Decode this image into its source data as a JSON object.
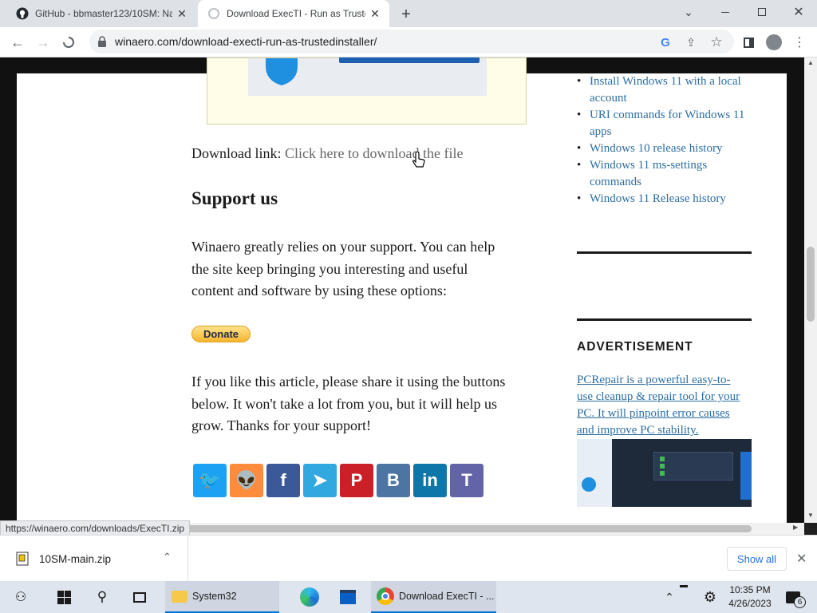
{
  "browser": {
    "tabs": [
      {
        "title": "GitHub - bbmaster123/10SM: Na",
        "active": false
      },
      {
        "title": "Download ExecTI - Run as Truste",
        "active": true
      }
    ],
    "url": "winaero.com/download-execti-run-as-trustedinstaller/",
    "status_url": "https://winaero.com/downloads/ExecTI.zip"
  },
  "article": {
    "download_label": "Download link:",
    "download_link": "Click here to download the file",
    "support_heading": "Support us",
    "support_lines": [
      "Winaero greatly relies on your support. You can help",
      "the site keep bringing you interesting and useful",
      "content and software by using these options:"
    ],
    "donate_label": "Donate",
    "share_lines": [
      "If you like this article, please share it using the buttons",
      "below. It won't take a lot from you, but it will help us",
      "grow. Thanks for your support!"
    ],
    "share_buttons": [
      {
        "icon": "twitter-icon",
        "glyph": "🐦",
        "color": "#1da1f2"
      },
      {
        "icon": "reddit-icon",
        "glyph": "👽",
        "color": "#ff8b3d"
      },
      {
        "icon": "facebook-icon",
        "glyph": "f",
        "color": "#3b5998"
      },
      {
        "icon": "telegram-icon",
        "glyph": "➤",
        "color": "#32a8e0"
      },
      {
        "icon": "pinterest-icon",
        "glyph": "P",
        "color": "#cb2027"
      },
      {
        "icon": "vk-icon",
        "glyph": "B",
        "color": "#4c75a3"
      },
      {
        "icon": "linkedin-icon",
        "glyph": "in",
        "color": "#0e76a8"
      },
      {
        "icon": "teams-icon",
        "glyph": "T",
        "color": "#6264a7"
      }
    ]
  },
  "sidebar": {
    "links": [
      {
        "lines": [
          "Install Windows 11 with a local",
          "account"
        ]
      },
      {
        "lines": [
          "URI commands for Windows 11",
          "apps"
        ]
      },
      {
        "lines": [
          "Windows 10 release history"
        ]
      },
      {
        "lines": [
          "Windows 11 ms-settings",
          "commands"
        ]
      },
      {
        "lines": [
          "Windows 11 Release history"
        ]
      }
    ],
    "ad_heading": "ADVERTISEMENT",
    "ad_lines": [
      "PCRepair is a powerful easy-to-",
      "use cleanup & repair tool for your",
      "PC. It will pinpoint error causes",
      "and improve PC stability."
    ]
  },
  "downloads": {
    "file_name": "10SM-main.zip",
    "show_all": "Show all"
  },
  "taskbar": {
    "explorer_label": "System32",
    "chrome_label": "Download ExecTI - ...",
    "time": "10:35 PM",
    "date": "4/26/2023",
    "notification_count": "6"
  }
}
